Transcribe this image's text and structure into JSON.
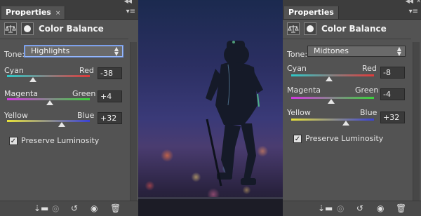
{
  "left_panel": {
    "tab_label": "Properties",
    "tab_close": "×",
    "menu_glyph": "▾≡",
    "adjustment_title": "Color Balance",
    "tone_label": "Tone:",
    "tone_value": "Highlights",
    "sliders": [
      {
        "left_label": "Cyan",
        "right_label": "Red",
        "value": "-38",
        "level": -38
      },
      {
        "left_label": "Magenta",
        "right_label": "Green",
        "value": "+4",
        "level": 4
      },
      {
        "left_label": "Yellow",
        "right_label": "Blue",
        "value": "+32",
        "level": 32
      }
    ],
    "preserve_label": "Preserve Luminosity",
    "preserve_checked": "✓"
  },
  "right_panel": {
    "tab_label": "Properties",
    "menu_glyph": "▾≡",
    "adjustment_title": "Color Balance",
    "tone_label": "Tone:",
    "tone_value": "Midtones",
    "sliders": [
      {
        "left_label": "Cyan",
        "right_label": "Red",
        "value": "-8",
        "level": -8
      },
      {
        "left_label": "Magenta",
        "right_label": "Green",
        "value": "-4",
        "level": -4
      },
      {
        "left_label": "Yellow",
        "right_label": "Blue",
        "value": "+32",
        "level": 32
      }
    ],
    "preserve_label": "Preserve Luminosity",
    "preserve_checked": "✓"
  },
  "footer_icons": [
    "clip-to-layer-icon",
    "view-previous-state-icon",
    "reset-icon",
    "visibility-eye-icon",
    "trash-icon"
  ],
  "colors": {
    "panel_bg": "#535353",
    "cyan_red_track": [
      "#2ec8c8",
      "#e03a3a"
    ],
    "magenta_green_track": [
      "#d23adf",
      "#3bd23b"
    ],
    "yellow_blue_track": [
      "#e8e23a",
      "#3a42d6"
    ]
  }
}
